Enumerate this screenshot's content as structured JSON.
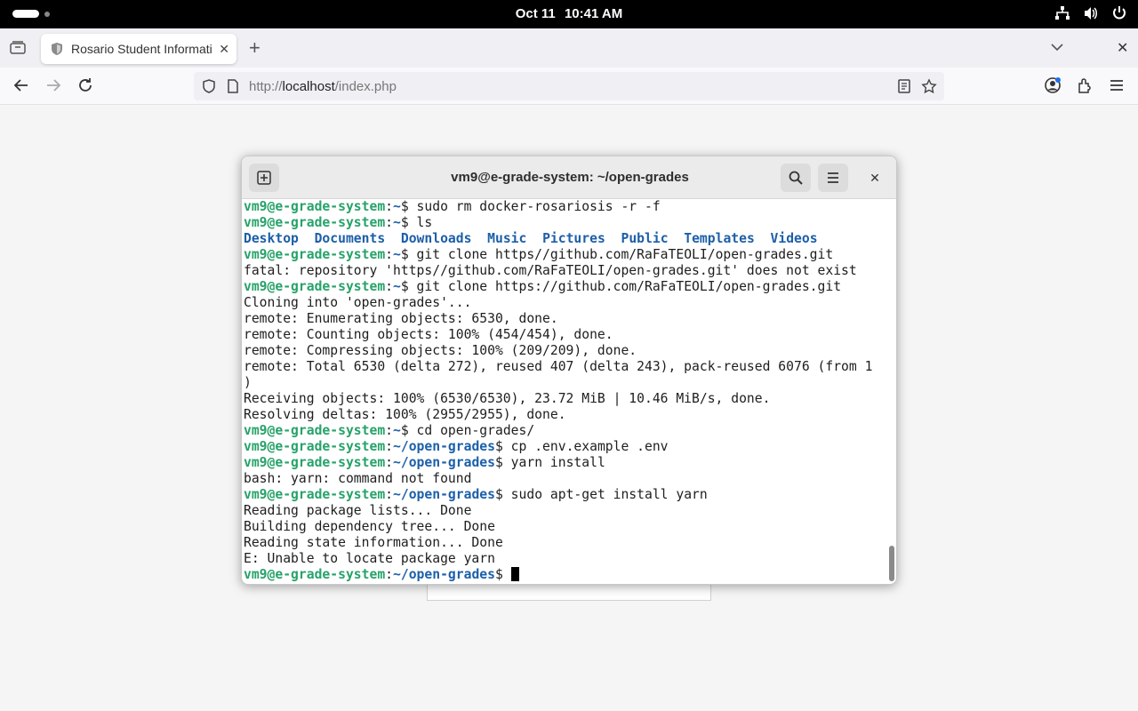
{
  "topbar": {
    "date": "Oct 11",
    "time": "10:41 AM",
    "tray_icons": [
      "network-icon",
      "volume-icon",
      "power-icon"
    ]
  },
  "browser": {
    "tab": {
      "title": "Rosario Student Informati",
      "favicon": "shield-favicon"
    },
    "url_prefix": "http://",
    "url_host": "localhost",
    "url_path": "/index.php"
  },
  "terminal": {
    "title": "vm9@e-grade-system: ~/open-grades",
    "prompt_user": "vm9@e-grade-system",
    "lines": [
      {
        "kind": "cmd",
        "path": "~",
        "text": "sudo rm docker-rosariosis -r -f"
      },
      {
        "kind": "cmd",
        "path": "~",
        "text": "ls"
      },
      {
        "kind": "dirs",
        "items": [
          "Desktop",
          "Documents",
          "Downloads",
          "Music",
          "Pictures",
          "Public",
          "Templates",
          "Videos"
        ]
      },
      {
        "kind": "cmd",
        "path": "~",
        "text": "git clone https//github.com/RaFaTEOLI/open-grades.git"
      },
      {
        "kind": "out",
        "text": "fatal: repository 'https//github.com/RaFaTEOLI/open-grades.git' does not exist"
      },
      {
        "kind": "cmd",
        "path": "~",
        "text": "git clone https://github.com/RaFaTEOLI/open-grades.git"
      },
      {
        "kind": "out",
        "text": "Cloning into 'open-grades'..."
      },
      {
        "kind": "out",
        "text": "remote: Enumerating objects: 6530, done."
      },
      {
        "kind": "out",
        "text": "remote: Counting objects: 100% (454/454), done."
      },
      {
        "kind": "out",
        "text": "remote: Compressing objects: 100% (209/209), done."
      },
      {
        "kind": "out",
        "text": "remote: Total 6530 (delta 272), reused 407 (delta 243), pack-reused 6076 (from 1"
      },
      {
        "kind": "out",
        "text": ")"
      },
      {
        "kind": "out",
        "text": "Receiving objects: 100% (6530/6530), 23.72 MiB | 10.46 MiB/s, done."
      },
      {
        "kind": "out",
        "text": "Resolving deltas: 100% (2955/2955), done."
      },
      {
        "kind": "cmd",
        "path": "~",
        "text": "cd open-grades/"
      },
      {
        "kind": "cmd",
        "path": "~/open-grades",
        "text": "cp .env.example .env"
      },
      {
        "kind": "cmd",
        "path": "~/open-grades",
        "text": "yarn install"
      },
      {
        "kind": "out",
        "text": "bash: yarn: command not found"
      },
      {
        "kind": "cmd",
        "path": "~/open-grades",
        "text": "sudo apt-get install yarn"
      },
      {
        "kind": "out",
        "text": "Reading package lists... Done"
      },
      {
        "kind": "out",
        "text": "Building dependency tree... Done"
      },
      {
        "kind": "out",
        "text": "Reading state information... Done"
      },
      {
        "kind": "out",
        "text": "E: Unable to locate package yarn"
      },
      {
        "kind": "prompt",
        "path": "~/open-grades",
        "text": ""
      }
    ]
  }
}
